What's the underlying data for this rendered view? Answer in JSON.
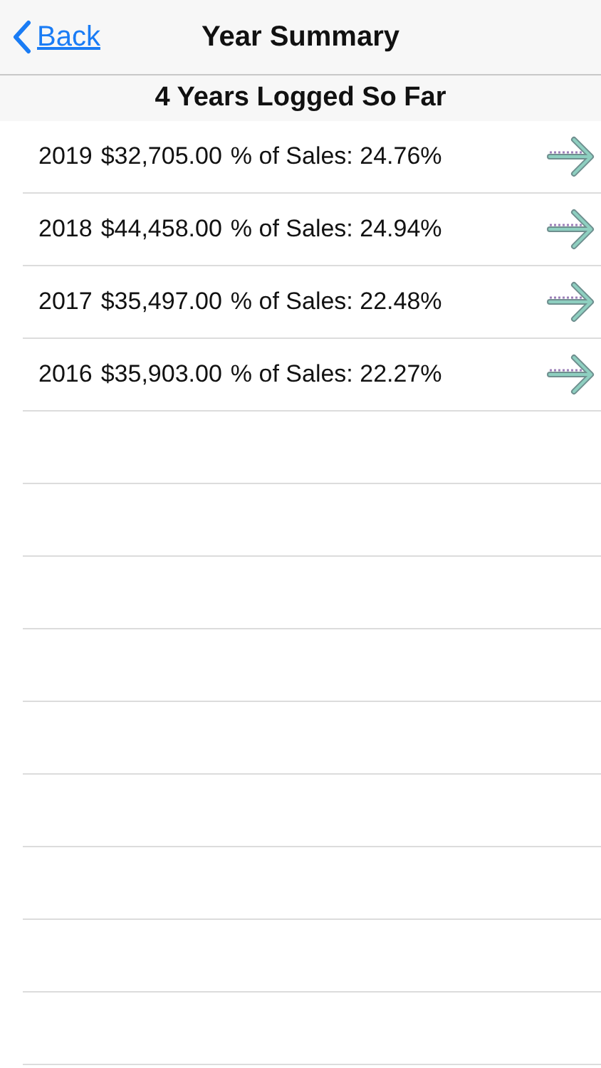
{
  "nav_bar": {
    "back_label": "Back",
    "title": "Year Summary"
  },
  "section_header": "4 Years Logged So Far",
  "rows": [
    {
      "year": "2019",
      "amount": "$32,705.00",
      "share": "% of Sales: 24.76%"
    },
    {
      "year": "2018",
      "amount": "$44,458.00",
      "share": "% of Sales: 24.94%"
    },
    {
      "year": "2017",
      "amount": "$35,497.00",
      "share": "% of Sales: 22.48%"
    },
    {
      "year": "2016",
      "amount": "$35,903.00",
      "share": "% of Sales: 22.27%"
    }
  ]
}
